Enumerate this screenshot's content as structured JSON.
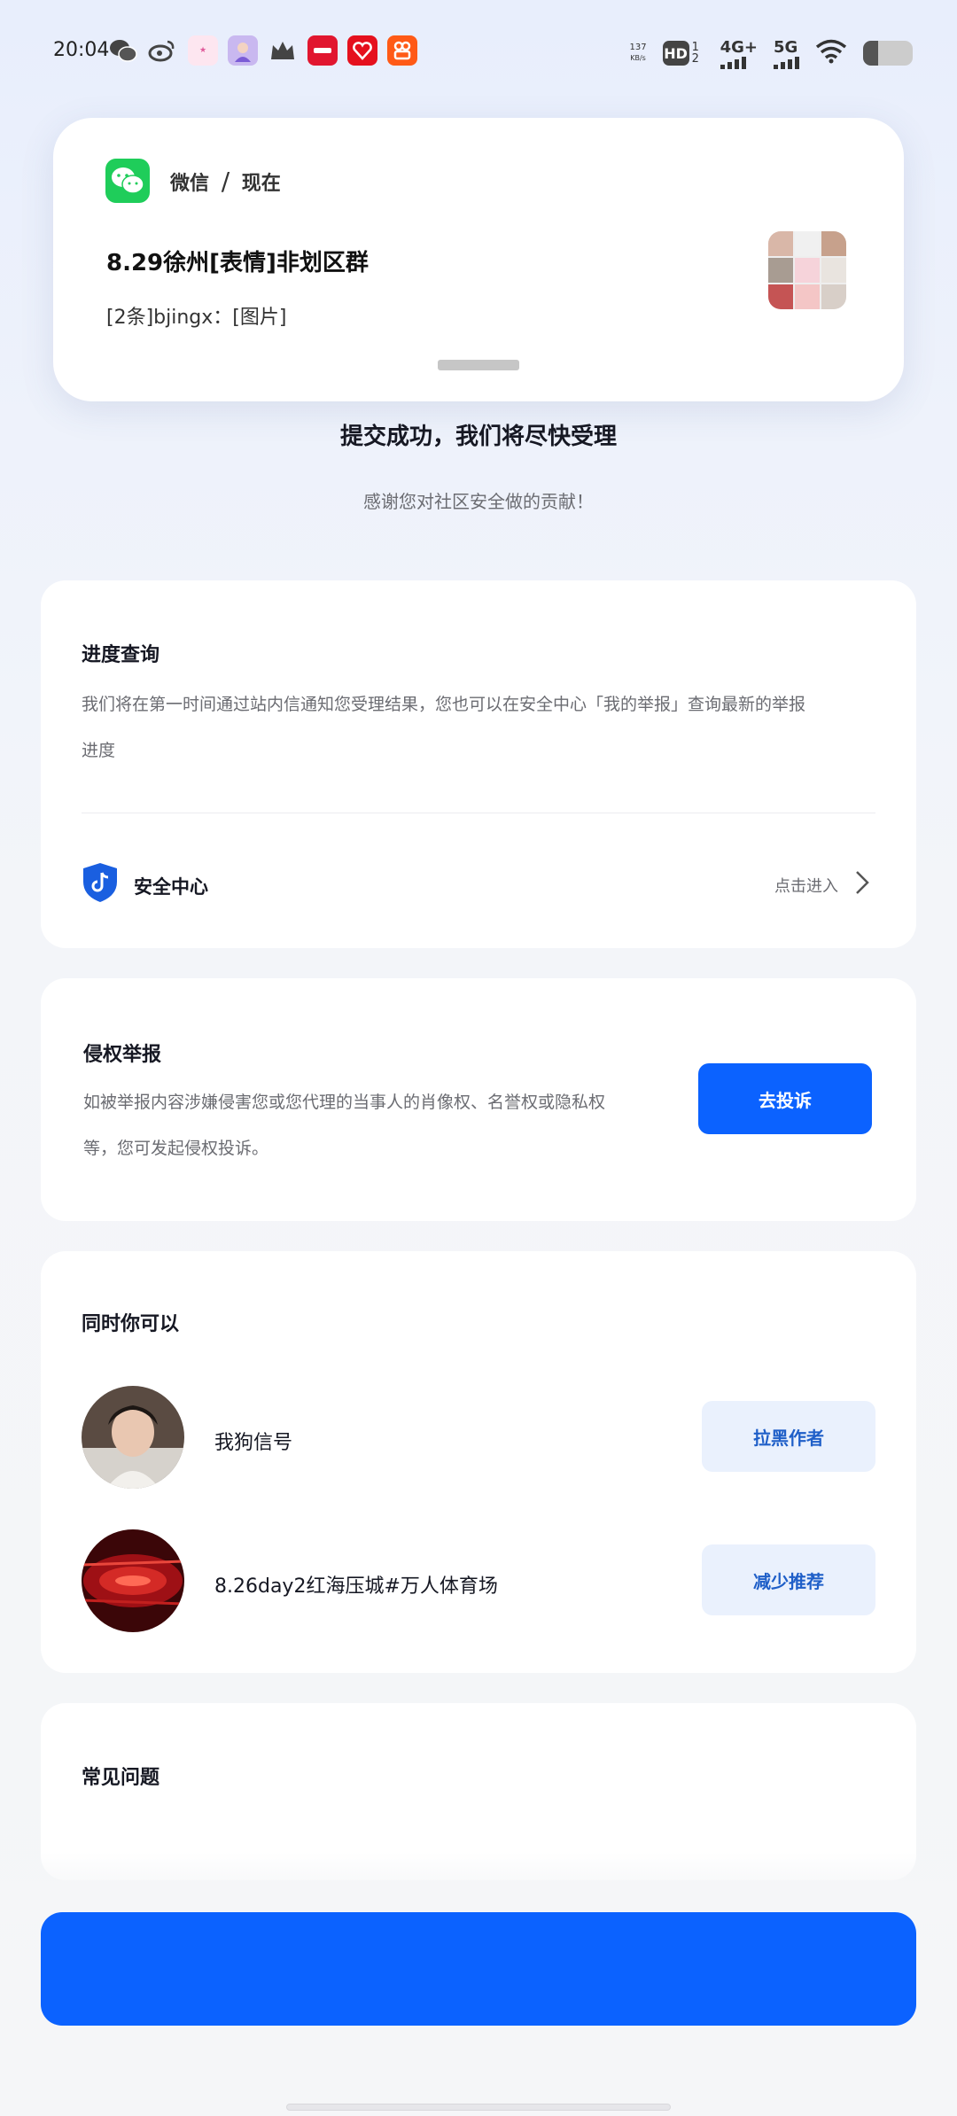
{
  "status_bar": {
    "time": "20:04",
    "speed_value": "137",
    "speed_unit": "KB/s",
    "hd_label": "HD",
    "hd_sub": "1 2",
    "net1": "4G+",
    "net2": "5G",
    "battery_level": 0.3,
    "app_icons": [
      "wechat-icon",
      "weibo-icon",
      "app-icon-pink",
      "avatar-app-icon",
      "crown-icon",
      "taobao-icon",
      "redbook-icon",
      "kuaishou-icon"
    ]
  },
  "notification": {
    "app_name": "微信",
    "separator": "/",
    "time": "现在",
    "title": "8.29徐州[表情]非划区群",
    "body": "[2条]bjingx：[图片]"
  },
  "result": {
    "title": "提交成功，我们将尽快受理",
    "subtitle": "感谢您对社区安全做的贡献！"
  },
  "progress_card": {
    "title": "进度查询",
    "text_line1": "我们将在第一时间通过站内信通知您受理结果，您也可以在安全中心「我的举报」查询最新的举报",
    "text_line2": "进度",
    "security_label": "安全中心",
    "enter_label": "点击进入"
  },
  "infringe_card": {
    "title": "侵权举报",
    "text_line1": "如被举报内容涉嫌侵害您或您代理的当事人的肖像权、名誉权或隐私权",
    "text_line2": "等，您可发起侵权投诉。",
    "button": "去投诉"
  },
  "also_card": {
    "title": "同时你可以",
    "rows": [
      {
        "label": "我狗信号",
        "button": "拉黑作者"
      },
      {
        "label": "8.26day2红海压城#万人体育场",
        "button": "减少推荐"
      }
    ]
  },
  "faq_card": {
    "title": "常见问题"
  },
  "colors": {
    "primary": "#0b62ff",
    "light_button": "#eaf1fd",
    "wechat_green": "#1fcd5a"
  }
}
